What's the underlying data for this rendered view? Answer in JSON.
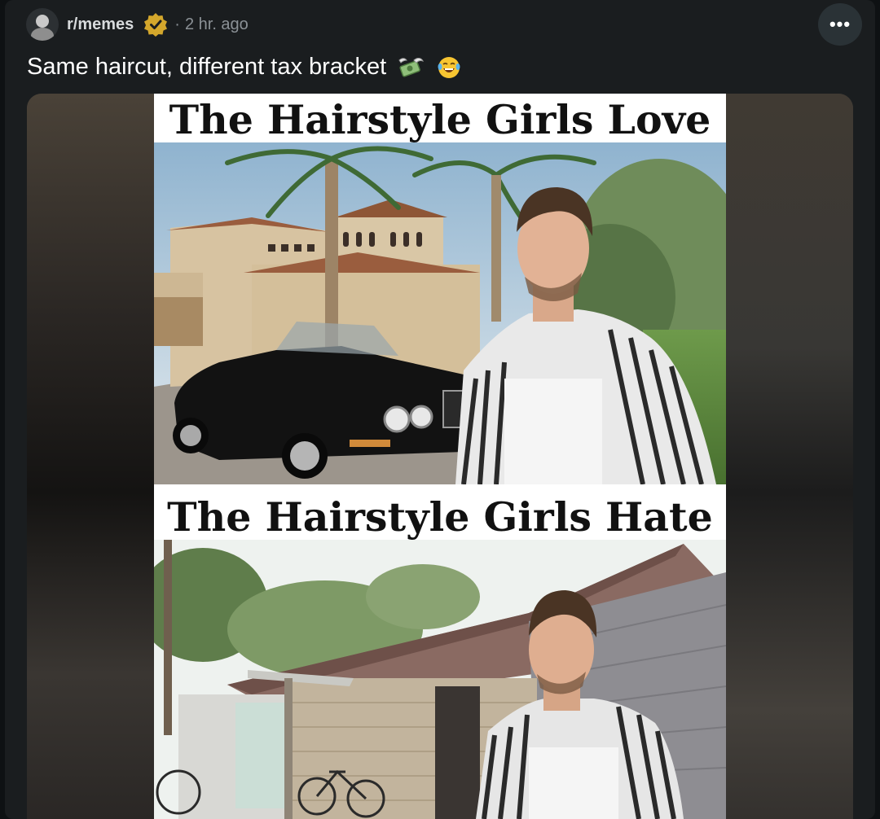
{
  "post": {
    "subreddit": "r/memes",
    "separator": "·",
    "time": "2 hr. ago",
    "title": "Same haircut, different tax bracket",
    "title_emojis": [
      "money-with-wings-icon",
      "laughing-tears-icon"
    ],
    "more_label": "•••"
  },
  "meme": {
    "top_caption": "The Hairstyle Girls Love",
    "bottom_caption": "The Hairstyle Girls Hate"
  },
  "colors": {
    "background": "#0e1113",
    "card": "#1a1d1f",
    "verified_badge": "#d4a72c",
    "meta_text": "#8b9196"
  }
}
